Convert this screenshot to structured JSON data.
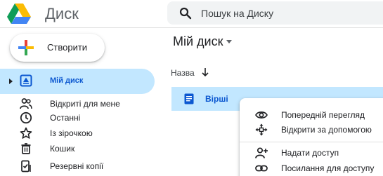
{
  "header": {
    "app_title": "Диск",
    "search_placeholder": "Пошук на Диску"
  },
  "sidebar": {
    "create_label": "Створити",
    "items": [
      {
        "label": "Мій диск",
        "icon": "drive-folder-icon",
        "active": true
      },
      {
        "label": "Відкриті для мене",
        "icon": "shared-people-icon"
      },
      {
        "label": "Останні",
        "icon": "clock-icon"
      },
      {
        "label": "Із зірочкою",
        "icon": "star-icon"
      },
      {
        "label": "Кошик",
        "icon": "trash-icon"
      },
      {
        "label": "Резервні копії",
        "icon": "backup-device-icon"
      }
    ]
  },
  "main": {
    "title": "Мій диск",
    "column_name": "Назва",
    "files": [
      {
        "name": "Вірші",
        "icon": "document-icon",
        "selected": true
      }
    ]
  },
  "context_menu": {
    "items": [
      {
        "label": "Попередній перегляд",
        "icon": "eye-icon"
      },
      {
        "label": "Відкрити за допомогою",
        "icon": "move-arrows-icon"
      },
      {
        "label": "Надати доступ",
        "icon": "add-person-icon"
      },
      {
        "label": "Посилання для доступу",
        "icon": "link-icon"
      }
    ]
  },
  "colors": {
    "accent": "#0b57d0",
    "selection": "#c2e7ff",
    "search_bg": "#f1f3f4"
  }
}
